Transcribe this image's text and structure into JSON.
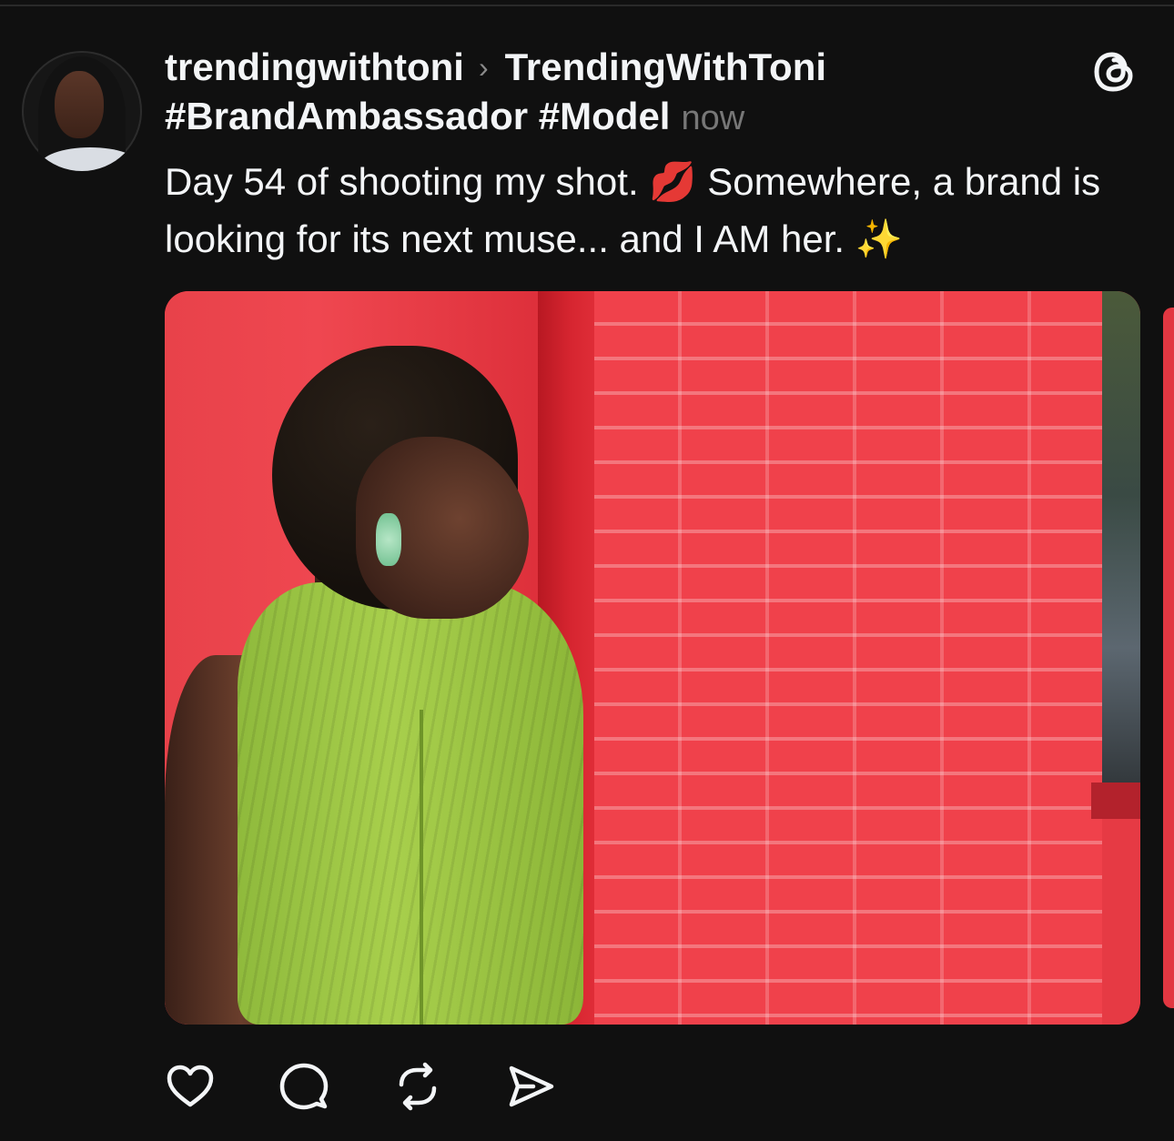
{
  "post": {
    "username": "trendingwithtoni",
    "community": "TrendingWithToni",
    "tags": "#BrandAmbassador #Model",
    "timestamp": "now",
    "text": "Day 54 of shooting my shot. 💋 Somewhere, a brand is looking for its next muse... and I AM her. ✨"
  },
  "icons": {
    "separator": "chevron-right",
    "logo": "threads-logo",
    "actions": [
      "heart-icon",
      "comment-icon",
      "repost-icon",
      "share-icon"
    ]
  },
  "colors": {
    "background": "#101010",
    "text": "#f3f5f7",
    "muted": "#777777"
  }
}
